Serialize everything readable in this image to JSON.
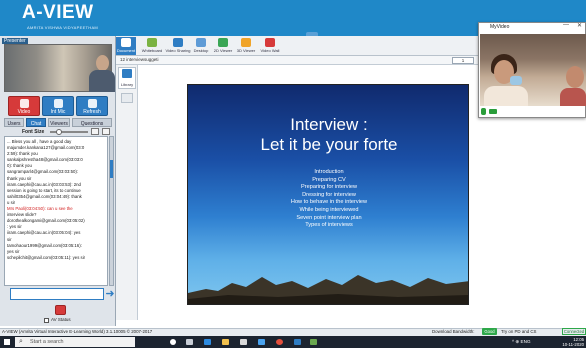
{
  "header": {
    "title": "A-VIEW",
    "subtitle": "AMRITA VISHWA VIDYAPEETHAM"
  },
  "left_panel": {
    "presenter_tag": "Presenter",
    "controls": [
      {
        "label": "Video"
      },
      {
        "label": "Int Mic"
      },
      {
        "label": "Refresh"
      }
    ],
    "tabs": [
      "Users",
      "Chat",
      "Viewers",
      "Questions"
    ],
    "active_tab": "Chat",
    "font_size_label": "Font Size",
    "chat_lines": [
      {
        "text": "... Bless you all , have a good day",
        "color": "normal"
      },
      {
        "text": "majumder.kankana127@gmail.com(03:0",
        "color": "normal"
      },
      {
        "text": "2:59): thank you",
        "color": "normal"
      },
      {
        "text": "sankalpshrestha48@gmail.com(03:03:0",
        "color": "normal"
      },
      {
        "text": "0): thank you",
        "color": "normal"
      },
      {
        "text": "sangramparl4@gmail.com(03:03:50):",
        "color": "normal"
      },
      {
        "text": "thank you sir",
        "color": "normal"
      },
      {
        "text": "iiram.caephi@cau.ac.in(03:03:53): 2nd",
        "color": "normal"
      },
      {
        "text": "session is going to start, its to continue",
        "color": "normal"
      },
      {
        "text": "sahil0354@gmail.com(03:04:49): thank",
        "color": "normal"
      },
      {
        "text": "u sir",
        "color": "normal"
      },
      {
        "text": "Mrs Paoli(03:04:50): can u see the",
        "color": "red"
      },
      {
        "text": "interview slide?",
        "color": "normal"
      },
      {
        "text": "dorothealkongami@gmail.com(03:05:02)",
        "color": "normal"
      },
      {
        "text": ": yes sir",
        "color": "normal"
      },
      {
        "text": "iiram.caephi@cau.ac.in(03:05:04): yes",
        "color": "normal"
      },
      {
        "text": "sir",
        "color": "normal"
      },
      {
        "text": "tamohaour1999@gmail.com(03:05:16):",
        "color": "normal"
      },
      {
        "text": "yes sir",
        "color": "normal"
      },
      {
        "text": "schepilchit@gmail.com(03:05:11): yes sir",
        "color": "normal"
      }
    ],
    "av_status": "AV Status"
  },
  "toolbar": {
    "tools": [
      "Document",
      "Whiteboard",
      "Video Sharing",
      "Desktop",
      "2D Viewer",
      "3D Viewer",
      "Video Wall"
    ]
  },
  "document": {
    "name": "12 interviewsuggeti",
    "page": "1",
    "library_label": "Library"
  },
  "slide": {
    "title_line1": "Interview :",
    "title_line2": "Let it be your forte",
    "points": [
      "Introduction",
      "Preparing CV",
      "Preparing for interview",
      "Dressing for interview",
      "How to behave in the interview",
      "While being interviewed",
      "Seven point interview plan",
      "Types of interviews"
    ]
  },
  "myvideo": {
    "title": "MyVideo",
    "minimize": "—",
    "close": "✕"
  },
  "footer": {
    "copyright": "A-VIEW (Amrita Virtual Interactive E-Learning World) 3.1.10005 © 2007-2017",
    "bandwidth_label": "Download Bandwidth:",
    "bandwidth_value": "Good",
    "tip": "Try on PD and CS",
    "status": "Connected"
  },
  "taskbar": {
    "search_placeholder": "Start a search",
    "tray": "^  ⊕  ENG",
    "time": "12:05",
    "date": "10-11-2020"
  },
  "colors": {
    "header_blue": "#1f88c8",
    "accent": "#2f7dc3",
    "danger": "#d63a3a",
    "good": "#2ea84a"
  }
}
